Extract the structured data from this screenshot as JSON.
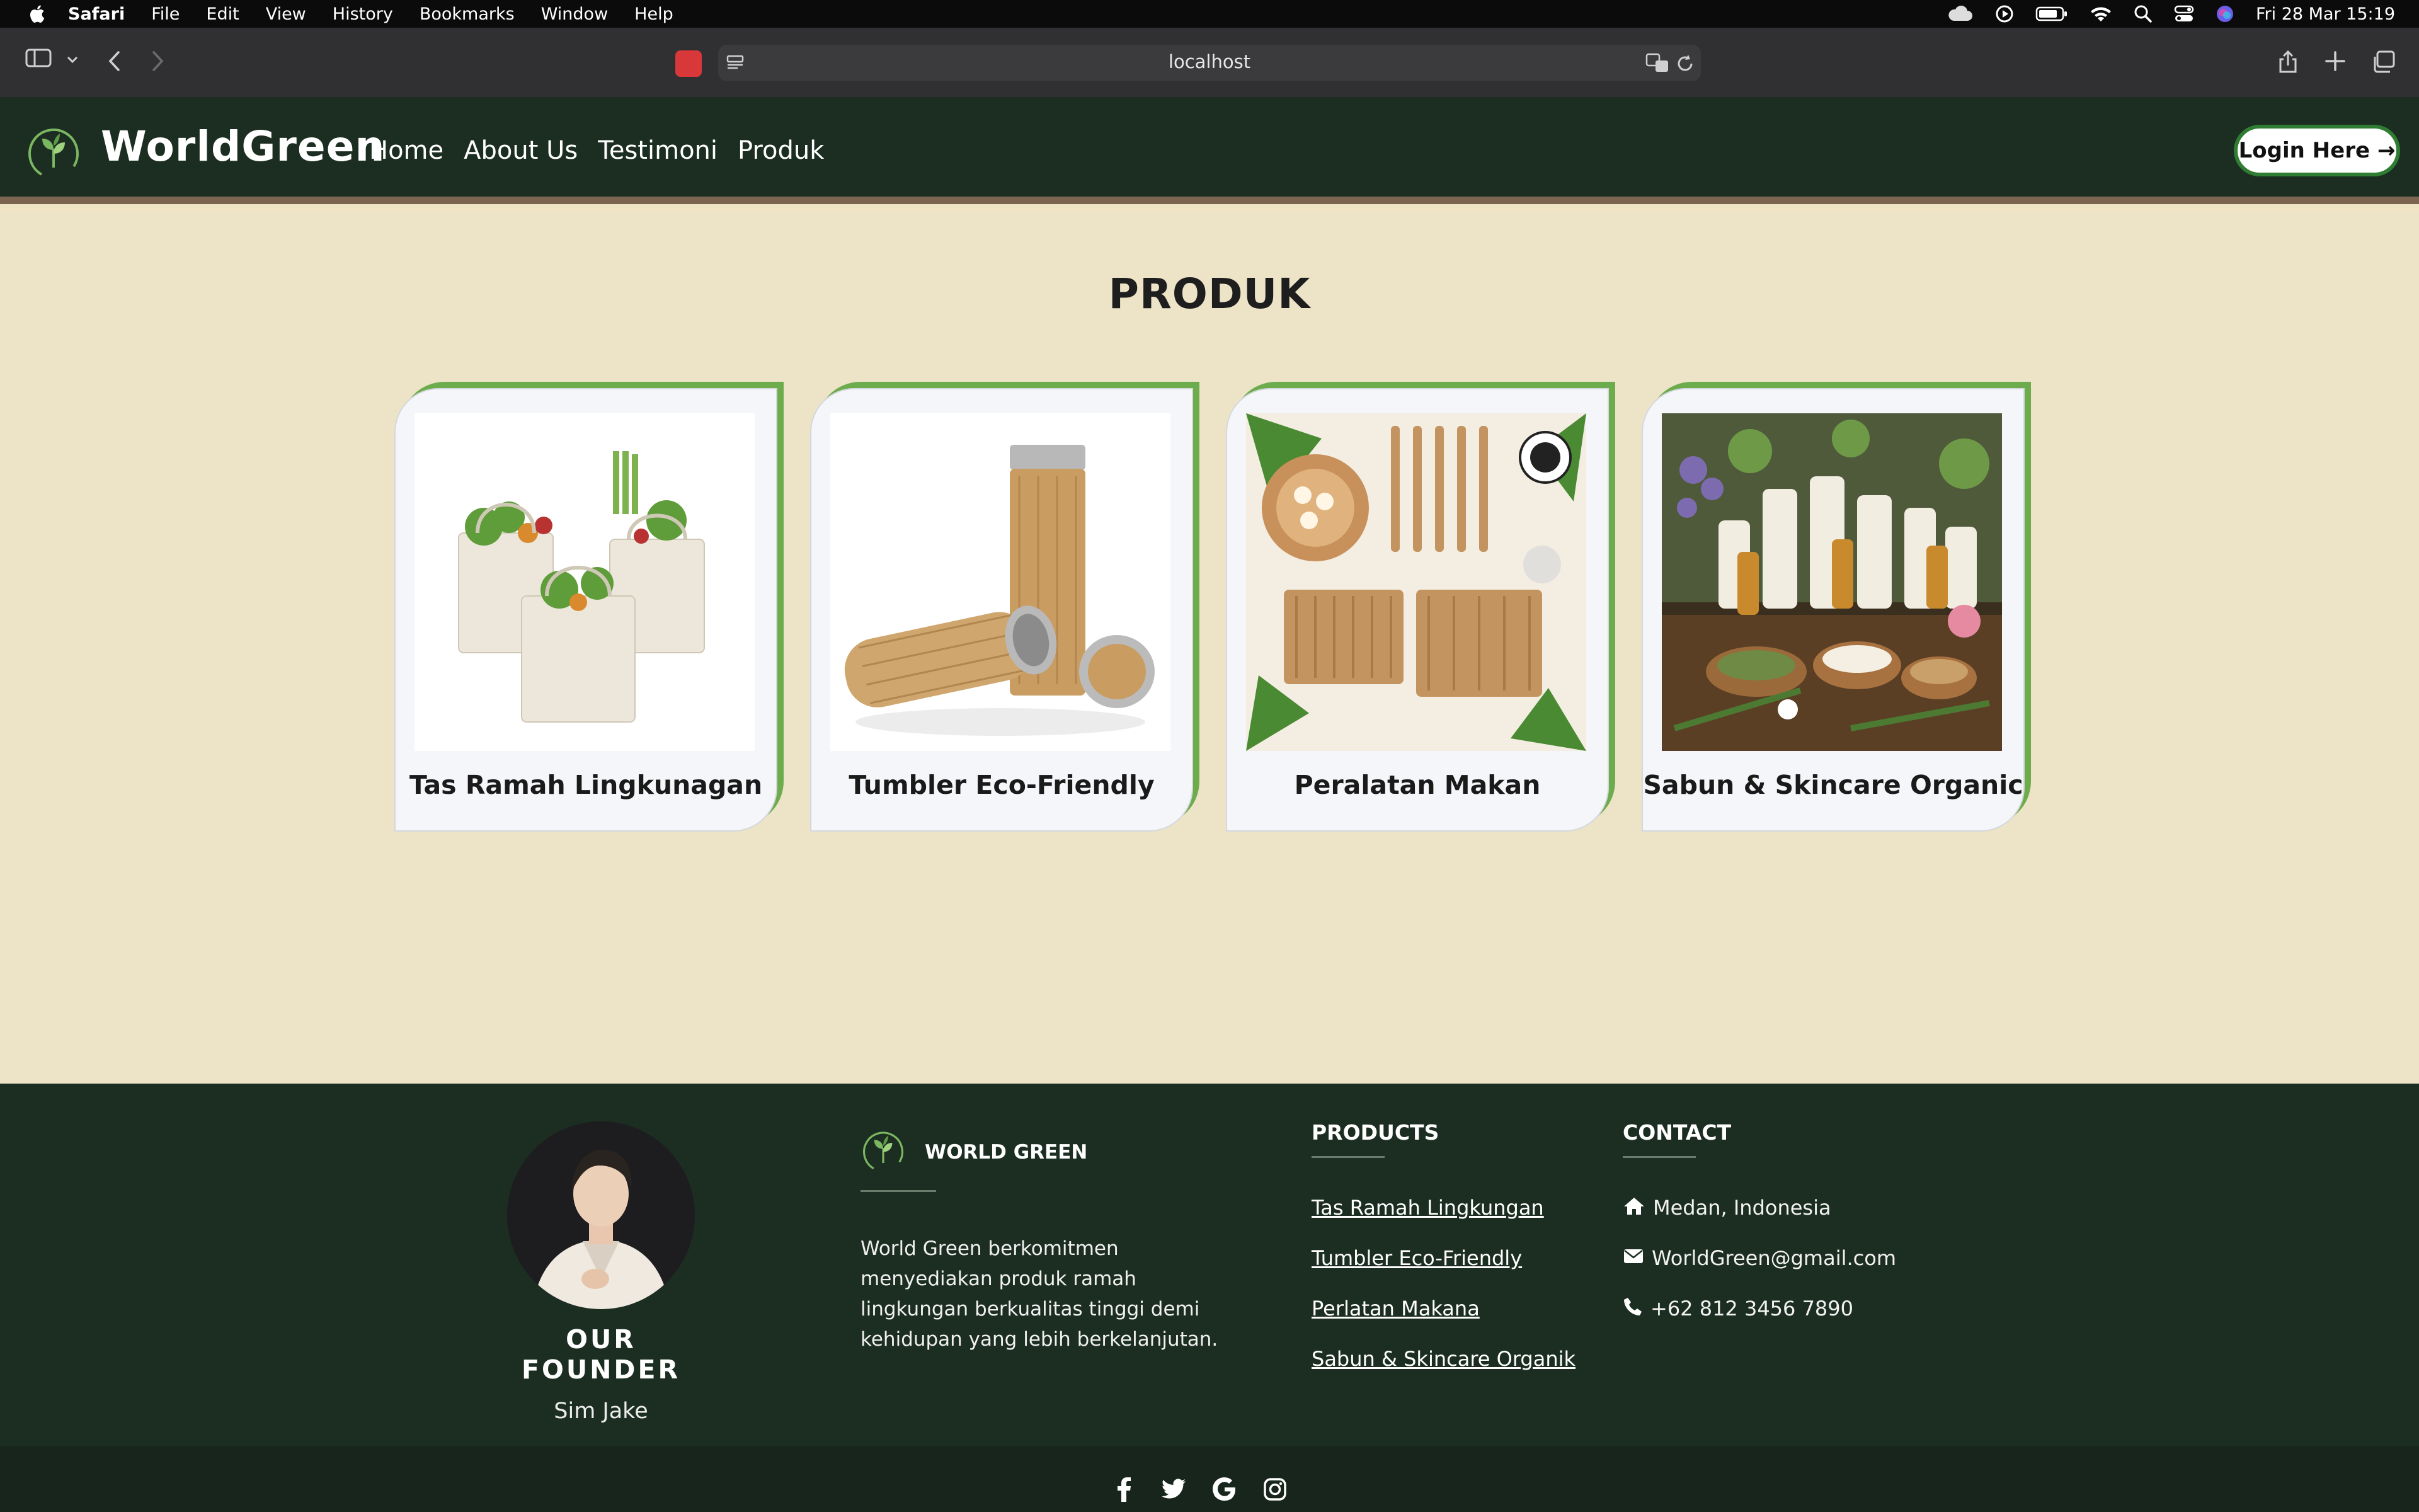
{
  "menubar": {
    "app": "Safari",
    "menus": [
      "File",
      "Edit",
      "View",
      "History",
      "Bookmarks",
      "Window",
      "Help"
    ],
    "datetime": "Fri 28 Mar  15:19"
  },
  "browser": {
    "url": "localhost"
  },
  "header": {
    "brand": "WorldGreen",
    "nav": [
      "Home",
      "About Us",
      "Testimoni",
      "Produk"
    ],
    "login": "Login Here →"
  },
  "main": {
    "title": "PRODUK",
    "products": [
      {
        "name": "Tas Ramah Lingkunagan"
      },
      {
        "name": "Tumbler Eco-Friendly"
      },
      {
        "name": "Peralatan Makan"
      },
      {
        "name": "Sabun & Skincare Organic"
      }
    ]
  },
  "footer": {
    "founder_title": "OUR FOUNDER",
    "founder_name": "Sim Jake",
    "about_title": "WORLD GREEN",
    "about_text": "World Green berkomitmen menyediakan produk ramah lingkungan berkualitas tinggi demi kehidupan yang lebih berkelanjutan.",
    "products_title": "PRODUCTS",
    "products_links": [
      "Tas Ramah Lingkungan",
      "Tumbler Eco-Friendly",
      "Perlatan Makana",
      "Sabun & Skincare Organik"
    ],
    "contact_title": "CONTACT",
    "contact": {
      "location": "Medan, Indonesia",
      "email": "WorldGreen@gmail.com",
      "phone": "+62 812 3456 7890"
    }
  },
  "colors": {
    "header_bg": "#1c2e22",
    "main_bg": "#ede4c7",
    "accent_green": "#6dac4d"
  }
}
